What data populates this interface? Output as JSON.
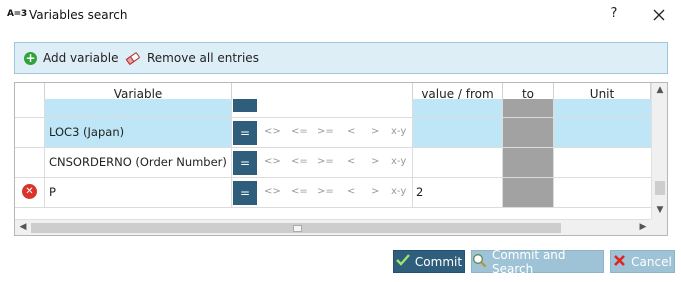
{
  "window": {
    "app_icon_text": "A=3",
    "title": "Variables search",
    "help_label": "?"
  },
  "toolbar": {
    "add_label": "Add variable",
    "remove_all_label": "Remove all entries"
  },
  "grid": {
    "columns": [
      "Variable",
      "value / from",
      "to",
      "Unit"
    ],
    "operators": [
      "=",
      "<>",
      "<=",
      ">=",
      "<",
      ">",
      "x-y"
    ],
    "rows": [
      {
        "variable": "",
        "value": "",
        "to": "",
        "unit": "",
        "highlighted": true,
        "partial": true,
        "deletable": false
      },
      {
        "variable": "LOC3 (Japan)",
        "value": "",
        "to": "",
        "unit": "",
        "highlighted": true,
        "partial": false,
        "deletable": false
      },
      {
        "variable": "CNSORDERNO (Order Number)",
        "value": "",
        "to": "",
        "unit": "",
        "highlighted": false,
        "partial": false,
        "deletable": false
      },
      {
        "variable": "P",
        "value": "2",
        "to": "",
        "unit": "",
        "highlighted": false,
        "partial": false,
        "deletable": true
      }
    ]
  },
  "buttons": {
    "commit": "Commit",
    "commit_and_search": "Commit and Search",
    "cancel": "Cancel"
  },
  "colors": {
    "highlight_row": "#bfe6f7",
    "operator_button": "#2f5e7d",
    "to_column": "#a2a2a2",
    "delete_icon": "#d9342a",
    "add_icon": "#2fa23a"
  }
}
